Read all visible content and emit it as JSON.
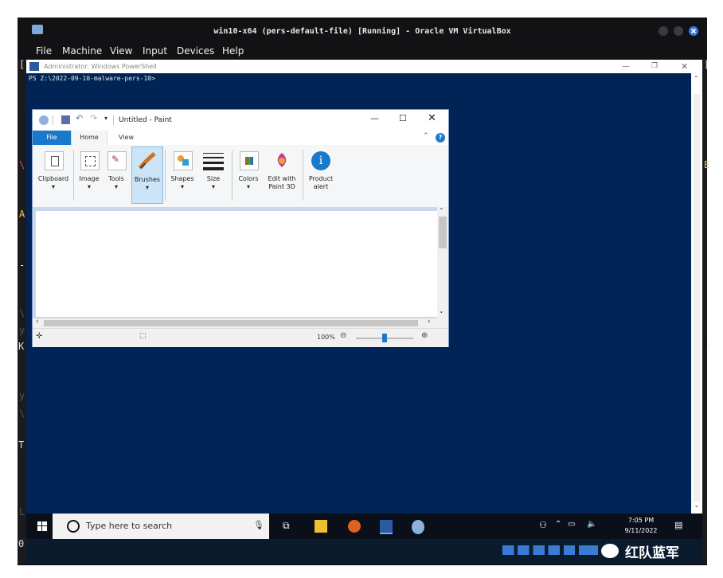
{
  "vm": {
    "title": "win10-x64 (pers-default-file) [Running] - Oracle VM VirtualBox",
    "menu": [
      "File",
      "Machine",
      "View",
      "Input",
      "Devices",
      "Help"
    ]
  },
  "host_gutter": {
    "left_chars": [
      "[",
      "\\",
      "A",
      "-",
      "\\",
      "y",
      "K",
      "y",
      "\\",
      "T",
      "L",
      "0"
    ],
    "right_chars": [
      "[",
      "E",
      "⋮"
    ]
  },
  "powershell": {
    "title": "Administrator: Windows PowerShell",
    "prompt": "PS Z:\\2022-09-10-malware-pers-10>"
  },
  "paint": {
    "title": "Untitled - Paint",
    "tabs": {
      "file": "File",
      "home": "Home",
      "view": "View"
    },
    "ribbon": [
      {
        "label": "Clipboard",
        "icon": "clipboard-icon"
      },
      {
        "label": "Image",
        "icon": "select-icon"
      },
      {
        "label": "Tools",
        "icon": "tools-icon"
      },
      {
        "label": "Brushes",
        "icon": "brush-icon"
      },
      {
        "label": "Shapes",
        "icon": "shapes-icon"
      },
      {
        "label": "Size",
        "icon": "size-icon"
      },
      {
        "label": "Colors",
        "icon": "colors-icon"
      },
      {
        "label_line1": "Edit with",
        "label_line2": "Paint 3D",
        "icon": "paint3d-icon"
      },
      {
        "label_line1": "Product",
        "label_line2": "alert",
        "icon": "info-icon"
      }
    ],
    "zoom": "100%",
    "zoom_fraction": 0.5
  },
  "taskbar": {
    "search_placeholder": "Type here to search",
    "time": "7:05 PM",
    "date": "9/11/2022"
  },
  "watermark": {
    "text": "红队蓝军"
  },
  "colors": {
    "ps_background": "#012456",
    "paint_accent": "#1979ca"
  }
}
